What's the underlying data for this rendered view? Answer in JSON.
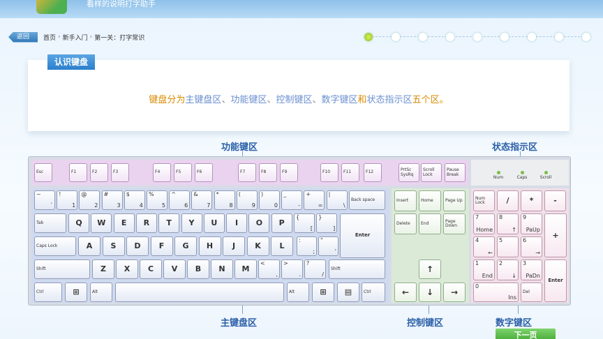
{
  "header": {
    "title": "看样的说明打字助手"
  },
  "breadcrumb": {
    "back": "返回",
    "items": [
      "首页",
      "新手入门",
      "第一关：打字常识"
    ]
  },
  "progress": {
    "total_steps": 9,
    "current_step": 1
  },
  "intro": {
    "tag": "认识键盘",
    "sentence": [
      {
        "t": "键盘分为",
        "c": "o"
      },
      {
        "t": "主键盘区",
        "c": "b"
      },
      {
        "t": "、",
        "c": "g"
      },
      {
        "t": "功能键区",
        "c": "b"
      },
      {
        "t": "、",
        "c": "g"
      },
      {
        "t": "控制键区",
        "c": "b"
      },
      {
        "t": "、",
        "c": "g"
      },
      {
        "t": "数字键区",
        "c": "b"
      },
      {
        "t": "和",
        "c": "o"
      },
      {
        "t": "状态指示区",
        "c": "b"
      },
      {
        "t": "五个区",
        "c": "o"
      },
      {
        "t": "。",
        "c": "o"
      }
    ]
  },
  "zones": {
    "function": "功能键区",
    "status": "状态指示区",
    "main": "主键盘区",
    "control": "控制键区",
    "numpad": "数字键区"
  },
  "indicators": [
    "Num",
    "Caps",
    "Scroll"
  ],
  "keys": {
    "function_row": [
      "Esc",
      "F1",
      "F2",
      "F3",
      "F4",
      "F5",
      "F6",
      "F7",
      "F8",
      "F9",
      "F10",
      "F11",
      "F12",
      "PrtSc SysRq",
      "Scroll Lock",
      "Pause Break"
    ],
    "number_row": [
      [
        "~",
        "`"
      ],
      [
        "!",
        "1"
      ],
      [
        "@",
        "2"
      ],
      [
        "#",
        "3"
      ],
      [
        "$",
        "4"
      ],
      [
        "%",
        "5"
      ],
      [
        "^",
        "6"
      ],
      [
        "&",
        "7"
      ],
      [
        "*",
        "8"
      ],
      [
        "(",
        "9"
      ],
      [
        ")",
        "0"
      ],
      [
        "_",
        "-"
      ],
      [
        "+",
        "="
      ],
      [
        "|",
        "\\"
      ]
    ],
    "backspace": "Back space",
    "tab": "Tab",
    "row_q": [
      "Q",
      "W",
      "E",
      "R",
      "T",
      "Y",
      "U",
      "I",
      "O",
      "P"
    ],
    "brackets": [
      [
        "{",
        "["
      ],
      [
        "}",
        "]"
      ]
    ],
    "enter": "Enter",
    "caps": "Caps Lock",
    "row_a": [
      "A",
      "S",
      "D",
      "F",
      "G",
      "H",
      "J",
      "K",
      "L"
    ],
    "semi": [
      [
        ":",
        ";"
      ],
      [
        "\"",
        "'"
      ]
    ],
    "shift": "Shift",
    "row_z": [
      "Z",
      "X",
      "C",
      "V",
      "B",
      "N",
      "M"
    ],
    "punct": [
      [
        "<",
        ","
      ],
      [
        ">",
        "."
      ],
      [
        "?",
        "/"
      ]
    ],
    "ctrl": "Ctrl",
    "alt": "Alt",
    "control_top": [
      "Insert",
      "Home",
      "Page Up",
      "Delete",
      "End",
      "Page Down"
    ],
    "arrows": [
      "↑",
      "←",
      "↓",
      "→"
    ],
    "numpad": {
      "r1": [
        "Num Lock",
        "/",
        "*",
        "-"
      ],
      "r2": [
        [
          "7",
          "Home"
        ],
        [
          "8",
          "↑"
        ],
        [
          "9",
          "PaUp"
        ]
      ],
      "plus": "+",
      "r3": [
        [
          "4",
          "←"
        ],
        [
          "5",
          ""
        ],
        [
          "6",
          "→"
        ]
      ],
      "r4": [
        [
          "1",
          "End"
        ],
        [
          "2",
          "↓"
        ],
        [
          "3",
          "PaDn"
        ]
      ],
      "enter": "Enter",
      "zero": [
        "0",
        "Ins"
      ],
      "del": "Del"
    }
  },
  "next_button": "下一页"
}
